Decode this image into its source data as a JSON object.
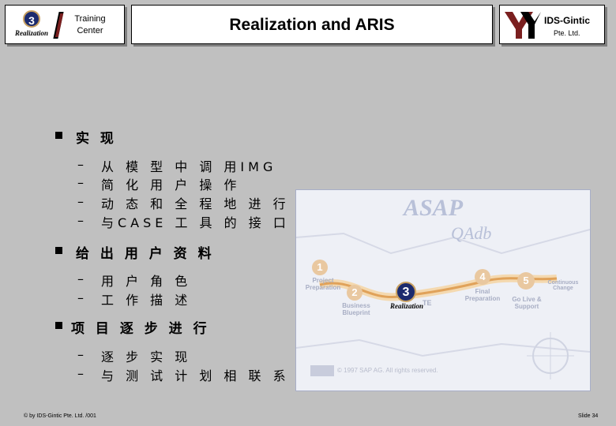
{
  "header": {
    "left_logo": {
      "badge_number": "3",
      "badge_label": "Realization",
      "training_line1": "Training",
      "training_line2": "Center"
    },
    "title": "Realization and ARIS",
    "right_logo": {
      "company": "IDS-Gintic",
      "sub": "Pte. Ltd."
    }
  },
  "body": {
    "items": [
      {
        "label": "实 现",
        "subs": [
          "从 模 型 中 调 用IMG",
          "简 化 用 户 操 作",
          "动 态 和 全 程 地 进 行 系 统",
          "与CASE 工 具 的 接 口"
        ]
      },
      {
        "label": "给 出 用 户 资 料",
        "subs": [
          "用 户 角 色",
          "工 作 描 述"
        ]
      },
      {
        "label": "项 目 逐 步 进 行",
        "subs": [
          "逐 步 实 现",
          "与 测 试 计 划 相 联 系"
        ]
      }
    ],
    "dash": "–"
  },
  "figure": {
    "brand": "ASAP",
    "brand_sub": "QAdb",
    "steps": [
      {
        "num": "1",
        "label": "Project Preparation"
      },
      {
        "num": "2",
        "label": "Business Blueprint"
      },
      {
        "num": "3",
        "label": "Realization"
      },
      {
        "num": "4",
        "label": "Final Preparation"
      },
      {
        "num": "5",
        "label": "Go Live & Support"
      }
    ],
    "continuous": "Continuous Change",
    "te_fragment": "TE",
    "copyright": "© 1997 SAP AG. All rights reserved."
  },
  "footer": {
    "left": "© by IDS-Gintic Pte. Ltd. /001",
    "right": "Slide 34"
  }
}
